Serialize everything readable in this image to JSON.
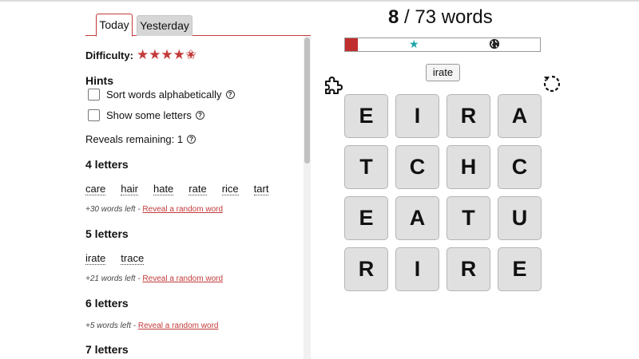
{
  "tabs": [
    {
      "label": "Today"
    },
    {
      "label": "Yesterday"
    }
  ],
  "difficulty": {
    "label": "Difficulty:",
    "rating": 4.5,
    "stars": "★★★★",
    "half_star": "✬"
  },
  "hints": {
    "title": "Hints",
    "sort_label": "Sort words alphabetically",
    "show_letters_label": "Show some letters"
  },
  "reveals": {
    "label": "Reveals remaining: 1"
  },
  "sections": [
    {
      "title": "4 letters",
      "words": [
        "care",
        "hair",
        "hate",
        "rate",
        "rice",
        "tart"
      ],
      "note": "+30 words left - ",
      "link": "Reveal a random word"
    },
    {
      "title": "5 letters",
      "words": [
        "irate",
        "trace"
      ],
      "note": "+21 words left - ",
      "link": "Reveal a random word"
    },
    {
      "title": "6 letters",
      "words": [],
      "note": "+5 words left - ",
      "link": "Reveal a random word"
    },
    {
      "title": "7 letters"
    }
  ],
  "score": {
    "found": "8",
    "rest": " / 73 words"
  },
  "progress_fraction": 0.065,
  "current_word": "irate",
  "grid": [
    [
      "E",
      "I",
      "R",
      "A"
    ],
    [
      "T",
      "C",
      "H",
      "C"
    ],
    [
      "E",
      "A",
      "T",
      "U"
    ],
    [
      "R",
      "I",
      "R",
      "E"
    ]
  ],
  "colors": {
    "accent": "#c33a3a",
    "progress": "#c12e2e",
    "star": "#1ea2a7",
    "tile": "#e0e0e0"
  },
  "icons": {
    "puzzle": "puzzle-icon",
    "rotate": "rotate-icon",
    "star": "star-icon",
    "globe": "globe-icon",
    "help": "help-icon"
  }
}
